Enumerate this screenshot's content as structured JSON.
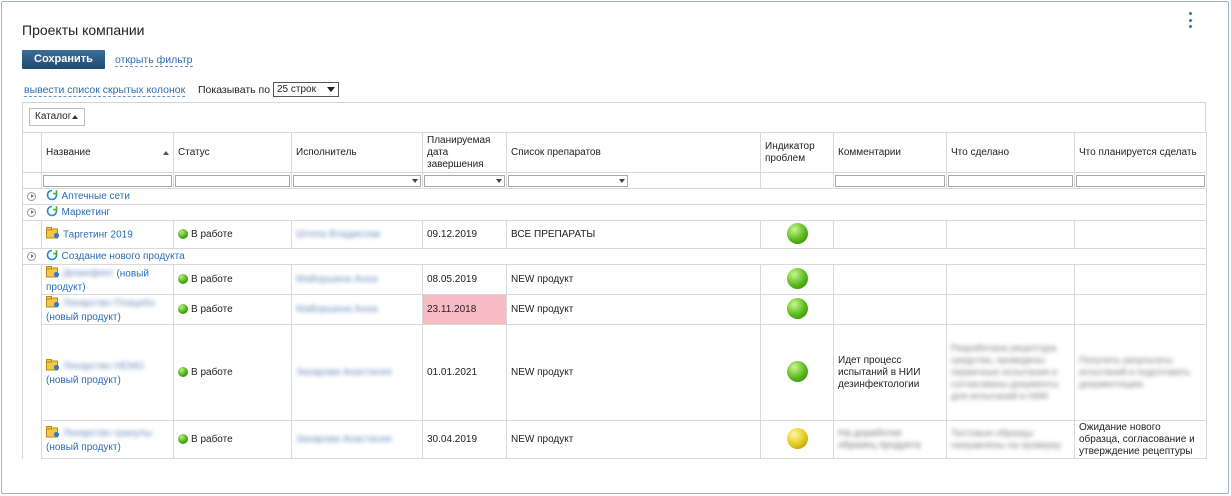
{
  "page": {
    "title": "Проекты компании",
    "save_label": "Сохранить",
    "open_filter_label": "открыть фильтр",
    "hidden_columns_label": "вывести список скрытых колонок",
    "rows_per_page_label": "Показывать по",
    "rows_per_page_value": "25 строк",
    "catalog_label": "Каталог"
  },
  "columns": [
    {
      "key": "name",
      "label": "Название",
      "sort": "asc"
    },
    {
      "key": "status",
      "label": "Статус"
    },
    {
      "key": "assignee",
      "label": "Исполнитель"
    },
    {
      "key": "due_date",
      "label": "Планируемая дата завершения"
    },
    {
      "key": "drugs",
      "label": "Список препаратов"
    },
    {
      "key": "indicator",
      "label": "Индикатор проблем"
    },
    {
      "key": "comments",
      "label": "Комментарии"
    },
    {
      "key": "done",
      "label": "Что сделано"
    },
    {
      "key": "planned",
      "label": "Что планируется сделать"
    }
  ],
  "groups": [
    {
      "label": "Аптечные сети",
      "rows": []
    },
    {
      "label": "Маркетинг",
      "rows": [
        {
          "name": "Таргетинг 2019",
          "name_suffix": "",
          "status": "В работе",
          "assignee": "Штепа Владислав",
          "due_date": "09.12.2019",
          "overdue": false,
          "drugs": "ВСЕ ПРЕПАРАТЫ",
          "indicator": "green",
          "comments": "",
          "done": "",
          "planned": ""
        }
      ]
    },
    {
      "label": "Создание нового продукта",
      "rows": [
        {
          "name": "Дезинфект",
          "name_suffix": "(новый продукт)",
          "status": "В работе",
          "assignee": "Майоршина Анна",
          "due_date": "08.05.2019",
          "overdue": false,
          "drugs": "NEW продукт",
          "indicator": "green",
          "comments": "",
          "done": "",
          "planned": ""
        },
        {
          "name": "Лекарство Плацебо",
          "name_suffix": "(новый продукт)",
          "status": "В работе",
          "assignee": "Майоршина Анна",
          "due_date": "23.11.2018",
          "overdue": true,
          "drugs": "NEW продукт",
          "indicator": "green",
          "comments": "",
          "done": "",
          "planned": ""
        },
        {
          "name": "Лекарство НЕМО",
          "name_suffix": "(новый продукт)",
          "status": "В работе",
          "assignee": "Захарова Анастасия",
          "due_date": "01.01.2021",
          "overdue": false,
          "drugs": "NEW продукт",
          "indicator": "green",
          "comments": "Идет процесс испытаний в НИИ дезинфектологии",
          "done": "Разработана рецептура средства, проведены первичные испытания и согласованы документы для испытаний в НИИ",
          "planned": "Получить результаты испытаний и подготовить документацию"
        },
        {
          "name": "Лекарство гранулы",
          "name_suffix": "(новый продукт)",
          "status": "В работе",
          "assignee": "Захарова Анастасия",
          "due_date": "30.04.2019",
          "overdue": false,
          "drugs": "NEW продукт",
          "indicator": "yellow",
          "comments": "На доработке образец продукта",
          "done": "Тестовые образцы направлены на проверку",
          "planned": "Ожидание нового образца, согласование и утверждение рецептуры"
        }
      ]
    }
  ],
  "colors": {
    "link": "#2a6db5",
    "save_button": "#1e4a70",
    "overdue_bg": "#f7bcc3",
    "indicator_green": "#58b81c",
    "indicator_yellow": "#e0c91a"
  },
  "icons": {
    "kebab": "kebab-menu-icon",
    "group": "refresh-group-icon",
    "project": "folder-project-icon",
    "expand": "expand-icon"
  }
}
